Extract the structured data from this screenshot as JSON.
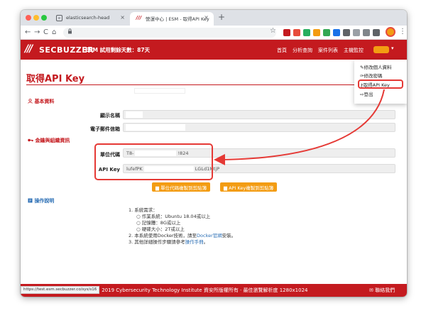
{
  "browser": {
    "tabs": [
      {
        "title": "elasticsearch-head",
        "favicon": "e",
        "close": "×"
      },
      {
        "title": "營運中心 | ESM - 取得API Key",
        "favicon": "///",
        "close": "×"
      }
    ],
    "new_tab": "+",
    "nav": {
      "back": "←",
      "forward": "→",
      "reload": "C",
      "home": "⌂"
    },
    "star": "☆",
    "menu": "⋮",
    "status_url": "https://test.esm.secbuzzer.co/sys/s16"
  },
  "header": {
    "logo_mark": "///",
    "logo_text": "SECBUZZER",
    "trial": "ESM 試用剩餘天數：87天",
    "nav": [
      "首頁",
      "分析查詢",
      "案件列表",
      "主機監控"
    ],
    "caret": "▾"
  },
  "page": {
    "title": "取得API Key",
    "sections": {
      "basic": "基本資料",
      "keys": "金鑰與組織資訊",
      "ops": "操作說明"
    },
    "fields": {
      "display_name_label": "顯示名稱",
      "email_label": "電子郵件信箱",
      "unit_code_label": "單位代碼",
      "unit_code_prefix": "T8-",
      "unit_code_suffix": "!824",
      "api_key_label": "API Key",
      "api_key_prefix": "lufefPK",
      "api_key_suffix": "LGLd1MtjP"
    },
    "buttons": {
      "copy_unit": "單位代碼複製到剪貼簿",
      "copy_key": "API Key複製到剪貼簿"
    },
    "instructions": {
      "line1": "1. 系統需求：",
      "bullet1": "○ 作業系統：Ubuntu 18.04或以上",
      "bullet2": "○ 記憶體：8G或以上",
      "bullet3": "○ 硬碟大小：2T或以上",
      "line2_pre": "2. 本系統使用Docker技術，請至",
      "line2_link": "Docker官網",
      "line2_post": "安裝。",
      "line3_pre": "3. 其他詳細操作步驟請參考",
      "line3_link": "操作手冊",
      "line3_post": "。"
    }
  },
  "dropdown": {
    "items": [
      "修改個人資料",
      "修改密碼",
      "取得API Key",
      "登出"
    ]
  },
  "footer": {
    "copyright": "© 2019 Cybersecurity Technology Institute 資安所版權所有 ‧ 最佳瀏覽解析度 1280x1024",
    "contact": "聯絡我們"
  },
  "colors": {
    "brand_red": "#c41a1f",
    "button_orange": "#f39c12",
    "link_blue": "#2c6fb5",
    "annotation_red": "#e53935"
  }
}
